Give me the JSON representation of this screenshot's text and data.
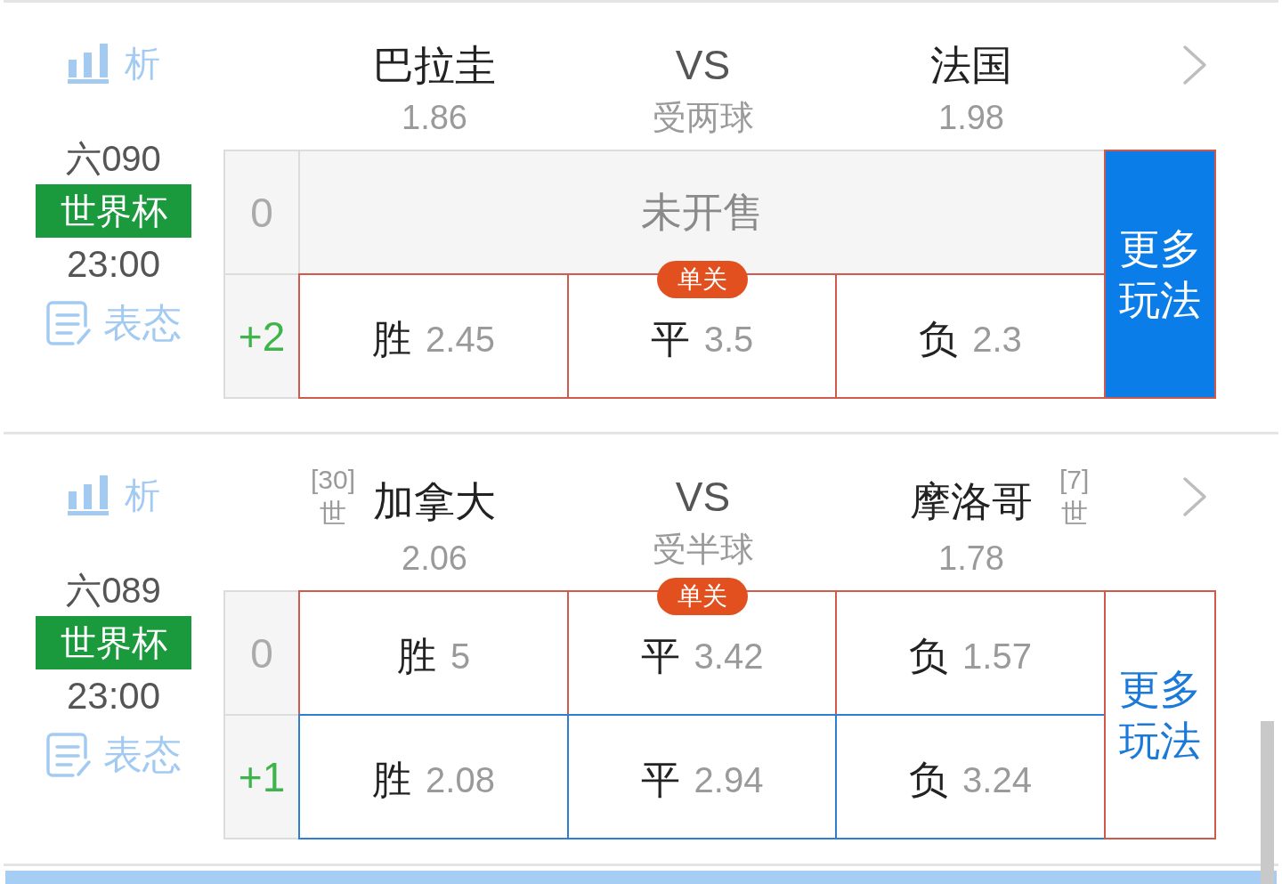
{
  "matches": [
    {
      "analysis_label": "析",
      "code": "六090",
      "league": "世界杯",
      "time": "23:00",
      "opinion_label": "表态",
      "home": {
        "name": "巴拉圭",
        "odds": "1.86"
      },
      "center": {
        "vs": "VS",
        "handicap_text": "受两球"
      },
      "away": {
        "name": "法国",
        "odds": "1.98"
      },
      "rows": [
        {
          "kind": "closed",
          "handicap": {
            "text": "0",
            "color": "#aaaaaa"
          },
          "status": "未开售"
        },
        {
          "kind": "odds",
          "handicap": {
            "text": "+2",
            "color": "#3db54a"
          },
          "color": "#cf5a4e",
          "badge": "单关",
          "cells": [
            {
              "outcome": "胜",
              "odds": "2.45"
            },
            {
              "outcome": "平",
              "odds": "3.5"
            },
            {
              "outcome": "负",
              "odds": "2.3"
            }
          ]
        }
      ],
      "more": {
        "label": "更多玩法",
        "active": true
      }
    },
    {
      "analysis_label": "析",
      "code": "六089",
      "league": "世界杯",
      "time": "23:00",
      "opinion_label": "表态",
      "home": {
        "name": "加拿大",
        "odds": "2.06",
        "rank": "[30]",
        "rank_tag": "世"
      },
      "center": {
        "vs": "VS",
        "handicap_text": "受半球"
      },
      "away": {
        "name": "摩洛哥",
        "odds": "1.78",
        "rank": "[7]",
        "rank_tag": "世"
      },
      "rows": [
        {
          "kind": "odds",
          "handicap": {
            "text": "0",
            "color": "#aaaaaa"
          },
          "color": "#cf5a4e",
          "badge": "单关",
          "cells": [
            {
              "outcome": "胜",
              "odds": "5"
            },
            {
              "outcome": "平",
              "odds": "3.42"
            },
            {
              "outcome": "负",
              "odds": "1.57"
            }
          ]
        },
        {
          "kind": "odds",
          "handicap": {
            "text": "+1",
            "color": "#3db54a"
          },
          "color": "#2f7fd0",
          "cells": [
            {
              "outcome": "胜",
              "odds": "2.08"
            },
            {
              "outcome": "平",
              "odds": "2.94"
            },
            {
              "outcome": "负",
              "odds": "3.24"
            }
          ]
        }
      ],
      "more": {
        "label": "更多玩法",
        "active": false
      }
    }
  ]
}
